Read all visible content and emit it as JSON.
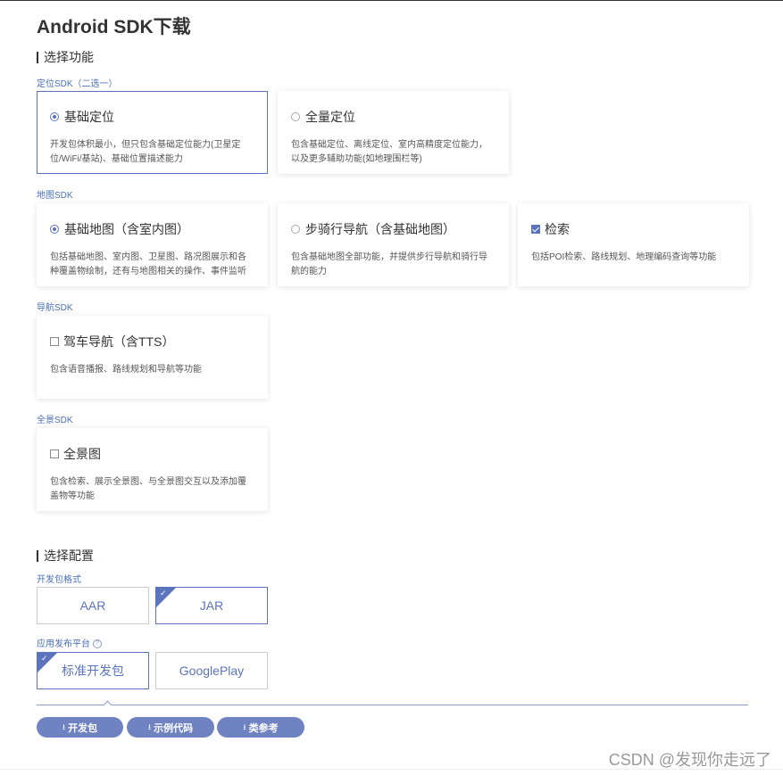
{
  "page": {
    "title": "Android SDK下载"
  },
  "section1": {
    "title": "选择功能",
    "groups": {
      "location": {
        "label": "定位SDK（二选一）",
        "cards": [
          {
            "title": "基础定位",
            "desc": "开发包体积最小，但只包含基础定位能力(卫星定位/WiFi/基站)、基础位置描述能力",
            "control": "radio",
            "checked": true,
            "selected": true
          },
          {
            "title": "全量定位",
            "desc": "包含基础定位、离线定位、室内高精度定位能力，以及更多辅助功能(如地理围栏等)",
            "control": "radio",
            "checked": false,
            "selected": false
          }
        ]
      },
      "map": {
        "label": "地图SDK",
        "cards": [
          {
            "title": "基础地图（含室内图）",
            "desc": "包括基础地图、室内图、卫星图、路况图展示和各种覆盖物绘制，还有与地图相关的操作、事件监听",
            "control": "radio",
            "checked": true
          },
          {
            "title": "步骑行导航（含基础地图）",
            "desc": "包含基础地图全部功能，并提供步行导航和骑行导航的能力",
            "control": "radio",
            "checked": false
          },
          {
            "title": "检索",
            "desc": "包括POI检索、路线规划、地理编码查询等功能",
            "control": "checkbox",
            "checked": true
          }
        ]
      },
      "nav": {
        "label": "导航SDK",
        "cards": [
          {
            "title": "驾车导航（含TTS）",
            "desc": "包含语音播报、路线规划和导航等功能",
            "control": "checkbox",
            "checked": false
          }
        ]
      },
      "pano": {
        "label": "全景SDK",
        "cards": [
          {
            "title": "全景图",
            "desc": "包含检索、展示全景图、与全景图交互以及添加覆盖物等功能",
            "control": "checkbox",
            "checked": false
          }
        ]
      }
    }
  },
  "section2": {
    "title": "选择配置",
    "format": {
      "label": "开发包格式",
      "options": [
        "AAR",
        "JAR"
      ],
      "selected": "JAR"
    },
    "platform": {
      "label": "应用发布平台",
      "help_icon": "question-circle-icon",
      "options": [
        "标准开发包",
        "GooglePlay"
      ],
      "selected": "标准开发包"
    }
  },
  "buttons": {
    "icon": "download-icon",
    "download": "开发包",
    "sample": "示例代码",
    "reference": "类参考"
  },
  "watermark": "CSDN @发现你走远了",
  "colors": {
    "accent": "#5b74bd",
    "button": "#6f82c2",
    "label": "#4a6fb5"
  }
}
